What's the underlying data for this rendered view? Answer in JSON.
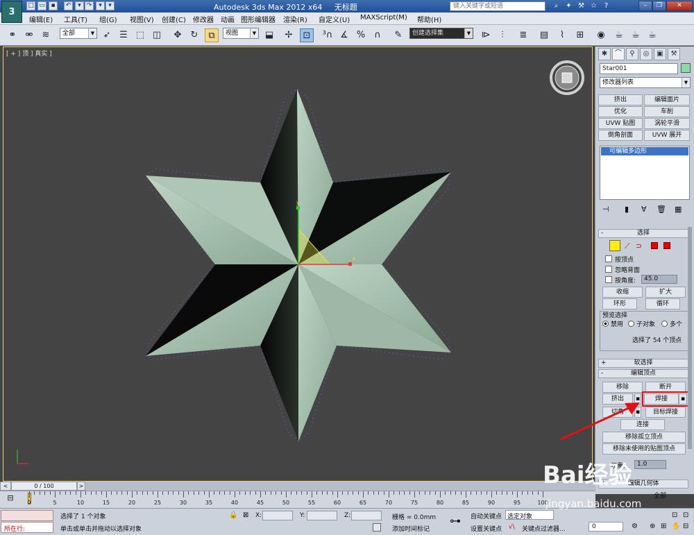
{
  "app": {
    "title": "Autodesk 3ds Max  2012 x64",
    "doc_title": "无标题",
    "logo": "3",
    "search_placeholder": "键入关键字或短语"
  },
  "menu": [
    "编辑(E)",
    "工具(T)",
    "组(G)",
    "视图(V)",
    "创建(C)",
    "修改器",
    "动画",
    "图形编辑器",
    "渲染(R)",
    "自定义(U)",
    "MAXScript(M)",
    "帮助(H)"
  ],
  "toolbar": {
    "selection_filter": "全部",
    "ref_coord": "视图",
    "named_sel": "创建选择集"
  },
  "viewport": {
    "label": "[ + ] 顶 ] 真实 ]"
  },
  "panel": {
    "object_name": "Star001",
    "object_color": "#8fd9a8",
    "modifier_list": "修改器列表",
    "modifier_buttons": [
      "挤出",
      "编辑面片",
      "优化",
      "车削",
      "UVW 贴图",
      "涡轮平滑",
      "倒角剖面",
      "UVW 展开"
    ],
    "stack_item": "可编辑多边形",
    "selection": {
      "title": "选择",
      "by_vertex": "按顶点",
      "ignore_back": "忽略背面",
      "by_angle": "按角度:",
      "angle_value": "45.0",
      "shrink": "收缩",
      "grow": "扩大",
      "ring": "环形",
      "loop": "循环",
      "preview_title": "预览选择",
      "preview_off": "禁用",
      "preview_sub": "子对象",
      "preview_multi": "多个",
      "selected_info": "选择了 54 个顶点"
    },
    "soft_selection": "软选择",
    "edit_vertices": {
      "title": "编辑顶点",
      "remove": "移除",
      "break": "断开",
      "extrude": "挤出",
      "weld": "焊接",
      "chamfer": "切角",
      "target_weld": "目标焊接",
      "connect": "连接",
      "remove_isolated": "移除孤立顶点",
      "remove_unused_map": "移除未使用的贴图顶点",
      "weight_label": "权重:",
      "weight_value": "1.0"
    },
    "next_rollout": "编辑几何体",
    "next_rollout2": "全部"
  },
  "timeline": {
    "frame_counter": "0 / 100",
    "ticks": [
      "0",
      "5",
      "10",
      "15",
      "20",
      "25",
      "30",
      "35",
      "40",
      "45",
      "50",
      "55",
      "60",
      "65",
      "70",
      "75",
      "80",
      "85",
      "90",
      "95",
      "100"
    ]
  },
  "status": {
    "prompt_left": "所在行:",
    "selected_text": "选择了 1 个对象",
    "hint_text": "单击或单击并拖动以选择对象",
    "x_label": "X:",
    "y_label": "Y:",
    "z_label": "Z:",
    "grid": "栅格 = 0.0mm",
    "add_time_tag": "添加时间标记",
    "auto_key": "自动关键点",
    "set_key": "设置关键点",
    "selected_obj": "选定对象",
    "key_filters": "关键点过滤器...",
    "frame_value": "0"
  },
  "watermark": {
    "brand": "Bai经验",
    "url": "jingyan.baidu.com"
  }
}
